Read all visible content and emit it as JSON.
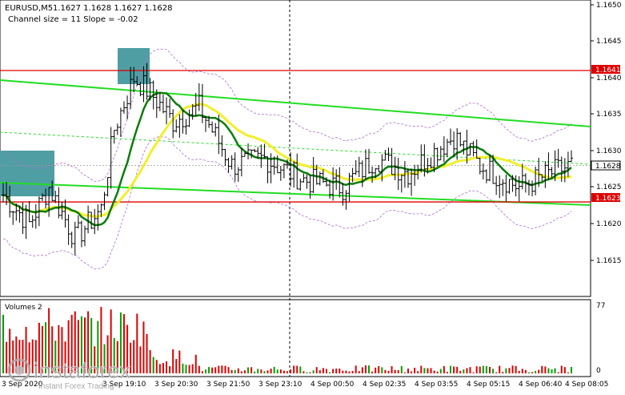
{
  "header": {
    "symbol": "EURUSD,M5",
    "ohlc": "1.1627 1.1628 1.1627 1.1628",
    "channel": "Channel size = 11 Slope = -0.02"
  },
  "volumes_label": "Volumes 2",
  "watermark": {
    "brand": "instaforex",
    "tagline": "Instant Forex Trading"
  },
  "colors": {
    "price_bar": "#000000",
    "ma_fast": "#0b7d0b",
    "ma_slow": "#f2ef2a",
    "channel": "#22dd22",
    "bands": "#b06bd6",
    "level_line": "#dd0000",
    "volume_bar": "#dd0000",
    "volume_bar_up": "#00a000",
    "current_price_tag": "#ffffff",
    "box": "#4f9ea3"
  },
  "price_axis": {
    "ticks": [
      "1.1650",
      "1.1645",
      "1.1640",
      "1.1635",
      "1.1630",
      "1.1625",
      "1.1620",
      "1.1615"
    ],
    "tick_values": [
      1.165,
      1.1645,
      1.164,
      1.1635,
      1.163,
      1.1625,
      1.162,
      1.1615
    ],
    "range": [
      1.16115,
      1.16505
    ]
  },
  "levels": {
    "upper": {
      "label": "1.1641",
      "value": 1.1641
    },
    "lower": {
      "label": "1.1623",
      "value": 1.1623
    },
    "current": {
      "label": "1.1628",
      "value": 1.1628
    }
  },
  "volume_axis": {
    "max_label": "77",
    "min_label": "0"
  },
  "time_axis": [
    "3 Sep 2020",
    "3 Sep 19:10",
    "3 Sep 20:30",
    "3 Sep 21:50",
    "3 Sep 23:10",
    "4 Sep 00:50",
    "4 Sep 02:35",
    "4 Sep 03:55",
    "4 Sep 05:15",
    "4 Sep 06:40",
    "4 Sep 08:05"
  ],
  "chart_data": {
    "type": "candlestick",
    "symbol": "EURUSD",
    "timeframe": "M5",
    "grid": false,
    "series": [
      {
        "name": "price",
        "start": 1.1625,
        "end": 1.1628,
        "high": 1.1642,
        "low": 1.1614
      },
      {
        "name": "volume",
        "max": 77
      }
    ],
    "annotations": [
      "Channel size = 11 Slope = -0.02"
    ]
  }
}
